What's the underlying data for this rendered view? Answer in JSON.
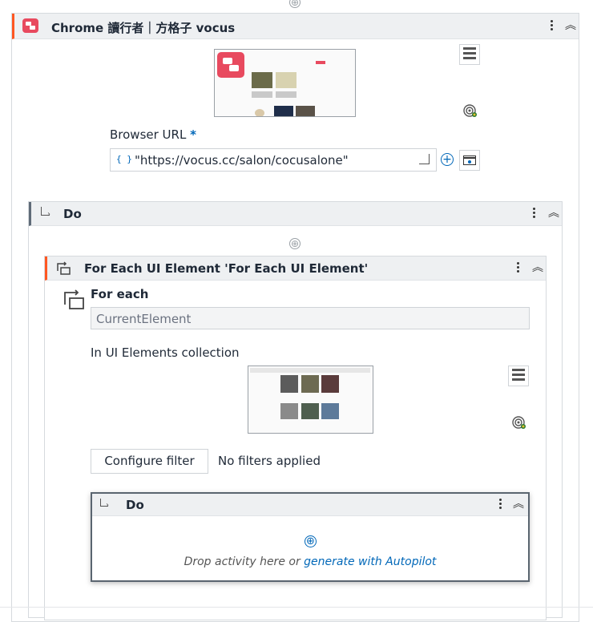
{
  "top_add": "⊕",
  "outer_card": {
    "title": "Chrome 讀行者｜方格子 vocus",
    "brand_color": "#e84a5f",
    "accent_color": "#ff5722",
    "menu_icon": "kebab-menu-icon",
    "collapse_icon": "chevron-double-up-icon"
  },
  "browser_url": {
    "label": "Browser URL",
    "required_mark": "*",
    "value": "\"https://vocus.cc/salon/cocusalone\"",
    "braces": "{ }"
  },
  "do_card": {
    "title": "Do",
    "add": "⊕"
  },
  "foreach_card": {
    "title": "For Each UI Element 'For Each UI Element'",
    "for_each_label": "For each",
    "current_element": "CurrentElement",
    "collection_label": "In UI Elements collection",
    "configure_filter": "Configure filter",
    "filter_status": "No filters applied"
  },
  "inner_do": {
    "title": "Do",
    "add": "⊕",
    "drop_text": "Drop activity here or",
    "autopilot_link": "generate with Autopilot",
    "link_color": "#0067b8"
  }
}
